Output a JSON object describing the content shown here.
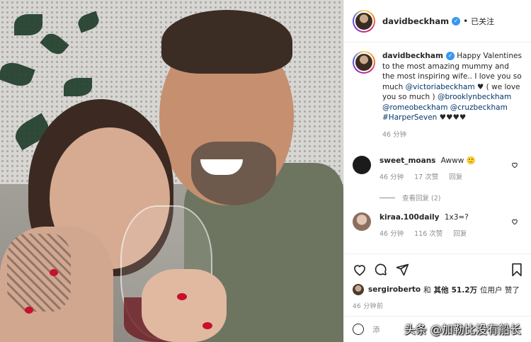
{
  "post": {
    "username": "davidbeckham",
    "follow_status": "已关注",
    "caption_text_1": "Happy Valentines to the most amazing mummy and the most inspiring wife.. I love you so much ",
    "caption_mention_1": "@victoriabeckham",
    "caption_text_2": " ♥ ( we love you so much ) ",
    "caption_mention_2": "@brooklynbeckham",
    "caption_mention_3": "@romeobeckham",
    "caption_mention_4": "@cruzbeckham",
    "caption_hashtag": "#HarperSeven",
    "caption_hearts": " ♥♥♥♥",
    "caption_time": "46 分钟"
  },
  "comments": [
    {
      "username": "sweet_moans",
      "text": "Awww 🙂",
      "time": "46 分钟",
      "likes": "17 次赞",
      "reply": "回复",
      "view_replies": "查看回复 (2)",
      "avatar_color": "#1b1b1b"
    },
    {
      "username": "kiraa.100daily",
      "text": "1x3=?",
      "time": "46 分钟",
      "likes": "116 次赞",
      "reply": "回复",
      "avatar_color": "#b79c8c"
    }
  ],
  "likes": {
    "liker": "sergiroberto",
    "conj": "和",
    "others": "其他",
    "count": "51.2万",
    "suffix": "位用户 赞了"
  },
  "post_time": "46 分钟前",
  "add_comment_placeholder": "添",
  "watermark": "头条 @加勒比没有船长",
  "colors": {
    "link": "#00376b",
    "verified": "#3897f0",
    "meta": "#8e8e8e"
  }
}
